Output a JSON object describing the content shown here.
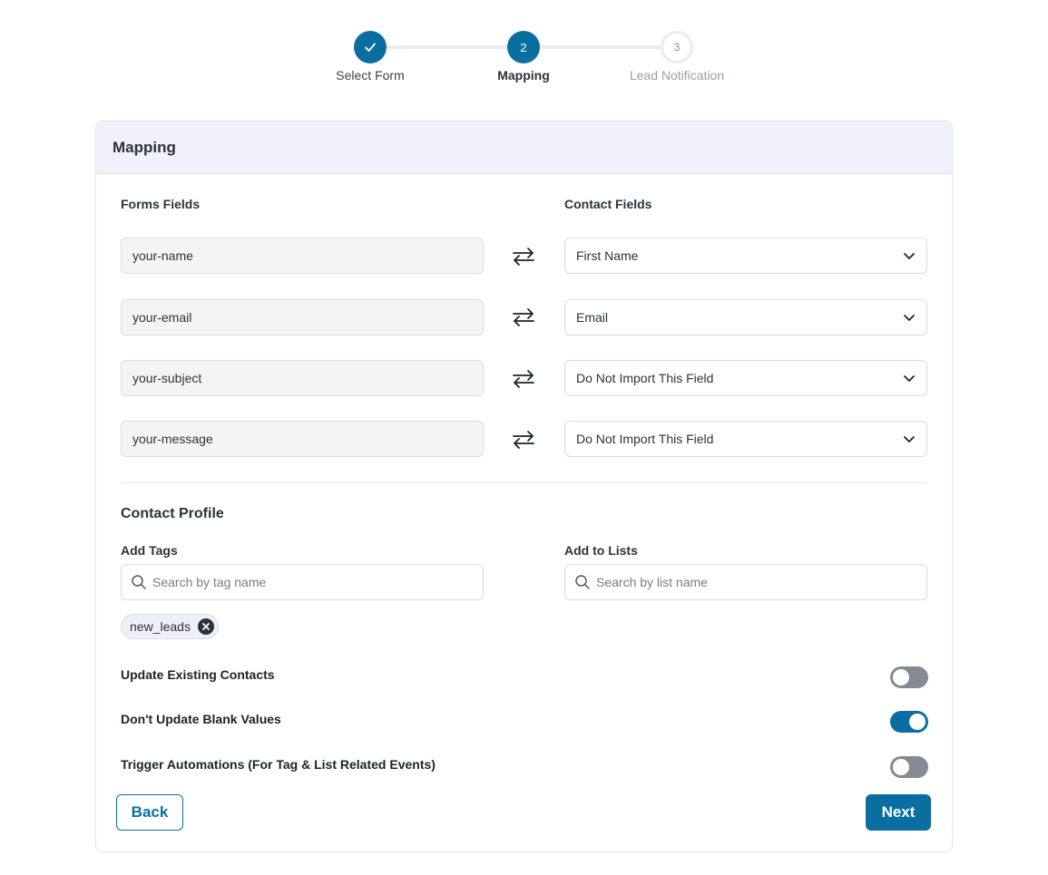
{
  "stepper": {
    "steps": [
      {
        "number": "",
        "label": "Select Form",
        "state": "done"
      },
      {
        "number": "2",
        "label": "Mapping",
        "state": "active"
      },
      {
        "number": "3",
        "label": "Lead Notification",
        "state": "pending"
      }
    ]
  },
  "card": {
    "title": "Mapping",
    "forms_fields_label": "Forms Fields",
    "contact_fields_label": "Contact Fields",
    "mappings": [
      {
        "form_field": "your-name",
        "contact_field": "First Name"
      },
      {
        "form_field": "your-email",
        "contact_field": "Email"
      },
      {
        "form_field": "your-subject",
        "contact_field": "Do Not Import This Field"
      },
      {
        "form_field": "your-message",
        "contact_field": "Do Not Import This Field"
      }
    ],
    "contact_profile": {
      "title": "Contact Profile",
      "add_tags_label": "Add Tags",
      "tags_placeholder": "Search by tag name",
      "add_lists_label": "Add to Lists",
      "lists_placeholder": "Search by list name",
      "tags": [
        "new_leads"
      ]
    },
    "toggles": [
      {
        "label": "Update Existing Contacts",
        "on": false
      },
      {
        "label": "Don't Update Blank Values",
        "on": true
      },
      {
        "label": "Trigger Automations (For Tag & List Related Events)",
        "on": false
      }
    ],
    "back_label": "Back",
    "next_label": "Next"
  },
  "colors": {
    "accent": "#0a6fa0",
    "header_bg": "#f0f1fa",
    "toggle_off": "#858a94"
  }
}
